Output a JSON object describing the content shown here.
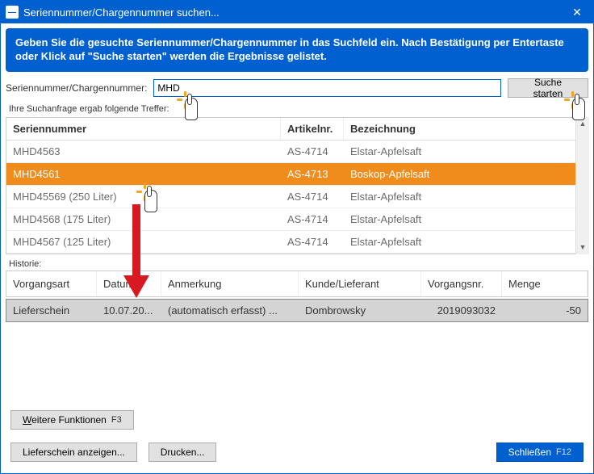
{
  "window": {
    "title": "Seriennummer/Chargennummer suchen..."
  },
  "banner": "Geben Sie die gesuchte Seriennummer/Chargennummer in das Suchfeld ein. Nach Bestätigung per Entertaste oder Klick auf \"Suche starten\" werden die Ergebnisse gelistet.",
  "search": {
    "label": "Seriennummer/Chargennummer:",
    "value": "MHD",
    "button": "Suche starten"
  },
  "result_msg": "Ihre Suchanfrage ergab folgende Treffer:",
  "grid": {
    "headers": {
      "serial": "Seriennummer",
      "artnr": "Artikelnr.",
      "desc": "Bezeichnung"
    },
    "rows": [
      {
        "serial": "MHD4563",
        "artnr": "AS-4714",
        "desc": "Elstar-Apfelsaft",
        "selected": false
      },
      {
        "serial": "MHD4561",
        "artnr": "AS-4713",
        "desc": "Boskop-Apfelsaft",
        "selected": true
      },
      {
        "serial": "MHD45569 (250 Liter)",
        "artnr": "AS-4714",
        "desc": "Elstar-Apfelsaft",
        "selected": false
      },
      {
        "serial": "MHD4568 (175 Liter)",
        "artnr": "AS-4714",
        "desc": "Elstar-Apfelsaft",
        "selected": false
      },
      {
        "serial": "MHD4567 (125 Liter)",
        "artnr": "AS-4714",
        "desc": "Elstar-Apfelsaft",
        "selected": false
      }
    ]
  },
  "history": {
    "label": "Historie:",
    "headers": {
      "type": "Vorgangsart",
      "date": "Datum",
      "note": "Anmerkung",
      "partner": "Kunde/Lieferant",
      "nr": "Vorgangsnr.",
      "qty": "Menge"
    },
    "rows": [
      {
        "type": "Lieferschein",
        "date": "10.07.20...",
        "note": "(automatisch erfasst) ...",
        "partner": "Dombrowsky",
        "nr": "2019093032",
        "qty": "-50"
      }
    ]
  },
  "buttons": {
    "more": "Weitere Funktionen",
    "more_key": "F3",
    "showdoc": "Lieferschein anzeigen...",
    "print": "Drucken...",
    "close": "Schließen",
    "close_key": "F12"
  }
}
